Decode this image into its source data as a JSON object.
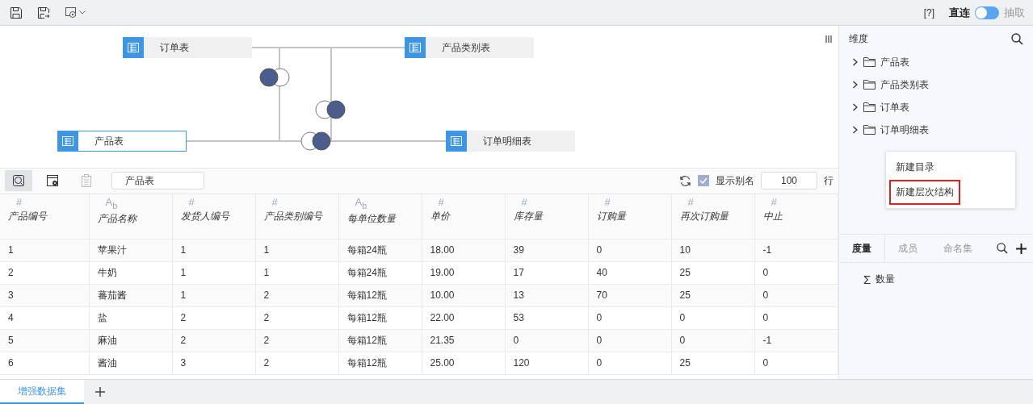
{
  "toolbar": {
    "help": "[?]",
    "mode_toggle": {
      "left_label": "直连",
      "right_label": "抽取",
      "right_on": false
    }
  },
  "canvas": {
    "nodes": [
      {
        "label": "订单表",
        "selected": false
      },
      {
        "label": "产品类别表",
        "selected": false
      },
      {
        "label": "产品表",
        "selected": true
      },
      {
        "label": "订单明细表",
        "selected": false
      }
    ]
  },
  "data_toolbar": {
    "tools": [
      {
        "kind": "preview",
        "selected": true,
        "disabled": false
      },
      {
        "kind": "settings",
        "selected": false,
        "disabled": false
      },
      {
        "kind": "clipboard",
        "selected": false,
        "disabled": true
      }
    ],
    "table_name": "产品表",
    "show_alias": {
      "label": "显示别名",
      "checked": true
    },
    "row_count": "100",
    "row_unit": "行"
  },
  "table": {
    "columns": [
      {
        "type_mark": "#",
        "name": "产品编号"
      },
      {
        "type_mark": "A$_{b}$",
        "name": "产品名称"
      },
      {
        "type_mark": "#",
        "name": "发货人编号"
      },
      {
        "type_mark": "#",
        "name": "产品类别编号"
      },
      {
        "type_mark": "A$_{b}$",
        "name": "每单位数量"
      },
      {
        "type_mark": "#",
        "name": "单价"
      },
      {
        "type_mark": "#",
        "name": "库存量"
      },
      {
        "type_mark": "#",
        "name": "订购量"
      },
      {
        "type_mark": "#",
        "name": "再次订购量"
      },
      {
        "type_mark": "#",
        "name": "中止"
      }
    ],
    "rows": [
      [
        "1",
        "苹果汁",
        "1",
        "1",
        "每箱24瓶",
        "18.00",
        "39",
        "0",
        "10",
        "-1"
      ],
      [
        "2",
        "牛奶",
        "1",
        "1",
        "每箱24瓶",
        "19.00",
        "17",
        "40",
        "25",
        "0"
      ],
      [
        "3",
        "蕃茄酱",
        "1",
        "2",
        "每箱12瓶",
        "10.00",
        "13",
        "70",
        "25",
        "0"
      ],
      [
        "4",
        "盐",
        "2",
        "2",
        "每箱12瓶",
        "22.00",
        "53",
        "0",
        "0",
        "0"
      ],
      [
        "5",
        "麻油",
        "2",
        "2",
        "每箱12瓶",
        "21.35",
        "0",
        "0",
        "0",
        "-1"
      ],
      [
        "6",
        "酱油",
        "3",
        "2",
        "每箱12瓶",
        "25.00",
        "120",
        "0",
        "25",
        "0"
      ]
    ]
  },
  "sidebar": {
    "dimensions": {
      "title": "维度",
      "items": [
        {
          "label": "产品表",
          "expanded": false
        },
        {
          "label": "产品类别表",
          "expanded": false
        },
        {
          "label": "订单表",
          "expanded": false
        },
        {
          "label": "订单明细表",
          "expanded": false
        }
      ]
    },
    "context_menu": [
      {
        "label": "新建目录",
        "selected": false
      },
      {
        "label": "新建层次结构",
        "selected": true
      }
    ],
    "tabs": [
      {
        "label": "度量",
        "selected": true
      },
      {
        "label": "成员",
        "selected": false
      },
      {
        "label": "命名集",
        "selected": false
      }
    ],
    "measures": [
      {
        "icon": "Σ",
        "label": "数量"
      }
    ]
  },
  "bottom_tabs": [
    {
      "label": "增强数据集",
      "selected": true
    }
  ]
}
